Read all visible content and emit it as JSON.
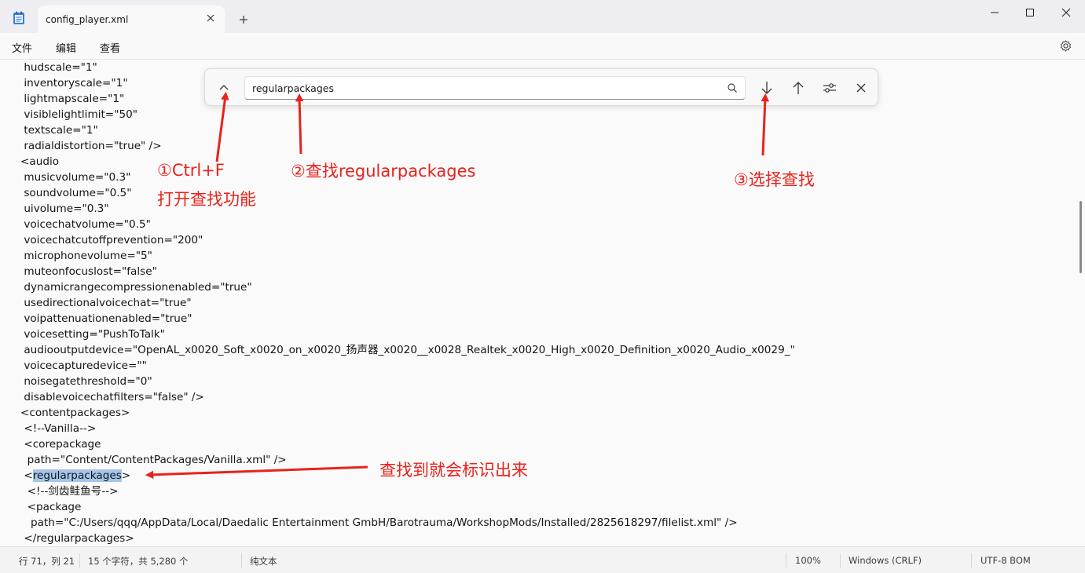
{
  "window": {
    "tab_title": "config_player.xml",
    "icons": [
      "notepad-icon",
      "close-icon",
      "plus-icon",
      "minimize-icon",
      "maximize-icon",
      "close-window-icon"
    ]
  },
  "menu": {
    "file": "文件",
    "edit": "编辑",
    "view": "查看"
  },
  "editor": {
    "lines": [
      " hudscale=\"1\"",
      " inventoryscale=\"1\"",
      " lightmapscale=\"1\"",
      " visiblelightlimit=\"50\"",
      " textscale=\"1\"",
      " radialdistortion=\"true\" />",
      "<audio",
      " musicvolume=\"0.3\"",
      " soundvolume=\"0.5\"",
      " uivolume=\"0.3\"",
      " voicechatvolume=\"0.5\"",
      " voicechatcutoffprevention=\"200\"",
      " microphonevolume=\"5\"",
      " muteonfocuslost=\"false\"",
      " dynamicrangecompressionenabled=\"true\"",
      " usedirectionalvoicechat=\"true\"",
      " voipattenuationenabled=\"true\"",
      " voicesetting=\"PushToTalk\"",
      " audiooutputdevice=\"OpenAL_x0020_Soft_x0020_on_x0020_扬声器_x0020__x0028_Realtek_x0020_High_x0020_Definition_x0020_Audio_x0029_\"",
      " voicecapturedevice=\"\"",
      " noisegatethreshold=\"0\"",
      " disablevoicechatfilters=\"false\" />",
      "<contentpackages>",
      " <!--Vanilla-->",
      " <corepackage",
      "  path=\"Content/ContentPackages/Vanilla.xml\" />"
    ],
    "highlight_line": {
      "prefix": " <",
      "match": "regularpackages",
      "suffix": ">"
    },
    "after_lines": [
      "  <!--剑齿鲑鱼号-->",
      "  <package",
      "   path=\"C:/Users/qqq/AppData/Local/Daedalic Entertainment GmbH/Barotrauma/WorkshopMods/Installed/2825618297/filelist.xml\" />",
      " </regularpackages>"
    ]
  },
  "find": {
    "query": "regularpackages",
    "icons": [
      "chevron-up-icon",
      "search-icon",
      "arrow-down-icon",
      "arrow-up-icon",
      "options-icon",
      "close-icon"
    ]
  },
  "annotations": {
    "step1_line1": "①Ctrl+F",
    "step1_line2": "打开查找功能",
    "step2": "②查找regularpackages",
    "step3": "③选择查找",
    "result": "查找到就会标识出来",
    "color": "#e8221c"
  },
  "status": {
    "position": "行 71，列 21",
    "selection": "15 个字符，共 5,280 个",
    "format": "纯文本",
    "zoom": "100%",
    "line_ending": "Windows (CRLF)",
    "encoding": "UTF-8 BOM"
  }
}
